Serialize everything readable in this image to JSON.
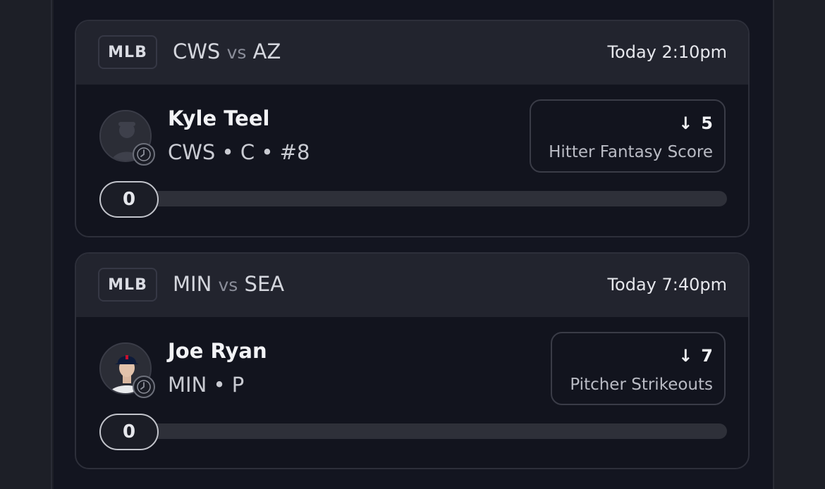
{
  "colors": {
    "bg": "#131520",
    "card_head": "#22242e",
    "track": "#2e3039",
    "pill_border": "#c2c4cb"
  },
  "picks": [
    {
      "league": "MLB",
      "away": "CWS",
      "vs": "vs",
      "home": "AZ",
      "time": "Today 2:10pm",
      "player_name": "Kyle Teel",
      "player_meta": "CWS • C • #8",
      "avatar_icon": "player-silhouette-icon",
      "direction_icon": "arrow-down-icon",
      "direction_glyph": "↓",
      "line": "5",
      "stat": "Hitter Fantasy Score",
      "progress_value": "0",
      "progress_fraction": 0
    },
    {
      "league": "MLB",
      "away": "MIN",
      "vs": "vs",
      "home": "SEA",
      "time": "Today 7:40pm",
      "player_name": "Joe Ryan",
      "player_meta": "MIN • P",
      "avatar_icon": "player-headshot",
      "direction_icon": "arrow-down-icon",
      "direction_glyph": "↓",
      "line": "7",
      "stat": "Pitcher Strikeouts",
      "progress_value": "0",
      "progress_fraction": 0
    }
  ]
}
